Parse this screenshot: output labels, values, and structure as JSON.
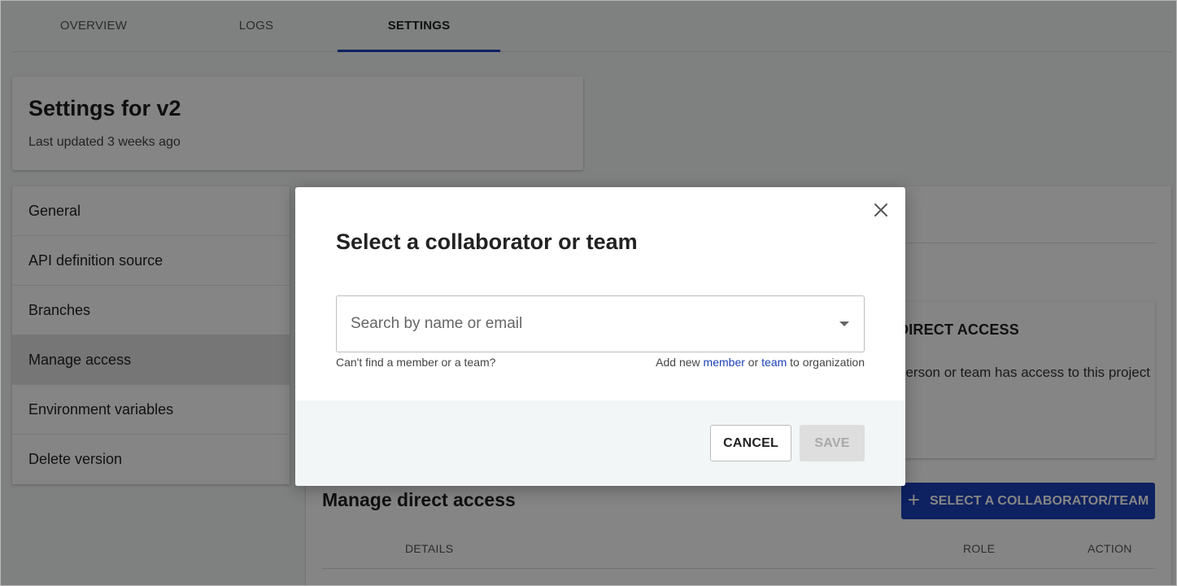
{
  "tabs": [
    {
      "label": "OVERVIEW",
      "active": false
    },
    {
      "label": "LOGS",
      "active": false
    },
    {
      "label": "SETTINGS",
      "active": true
    }
  ],
  "header": {
    "title": "Settings for v2",
    "subtitle": "Last updated 3 weeks ago"
  },
  "sidebar": {
    "items": [
      {
        "label": "General"
      },
      {
        "label": "API definition source"
      },
      {
        "label": "Branches"
      },
      {
        "label": "Manage access",
        "active": true
      },
      {
        "label": "Environment variables"
      },
      {
        "label": "Delete version"
      }
    ]
  },
  "main": {
    "info_card": {
      "title": "DIRECT ACCESS",
      "description": "person or team has access to this project"
    },
    "manage_title": "Manage direct access",
    "select_button": "SELECT A COLLABORATOR/TEAM",
    "table": {
      "headers": [
        "DETAILS",
        "ROLE",
        "ACTION"
      ]
    }
  },
  "modal": {
    "title": "Select a collaborator or team",
    "search": {
      "placeholder": "Search by name or email",
      "value": ""
    },
    "help_left": "Can't find a member or a team?",
    "help_right": {
      "prefix": "Add new",
      "member_link": "member",
      "or": "or",
      "team_link": "team",
      "suffix": "to organization"
    },
    "cancel_label": "CANCEL",
    "save_label": "SAVE"
  },
  "colors": {
    "accent": "#1b40b8",
    "overlay": "rgba(0,0,0,0.48)",
    "footer_bg": "#f3f6f6"
  },
  "icons": {
    "close": "close-icon",
    "dropdown": "chevron-down-icon",
    "plus": "plus-icon"
  }
}
